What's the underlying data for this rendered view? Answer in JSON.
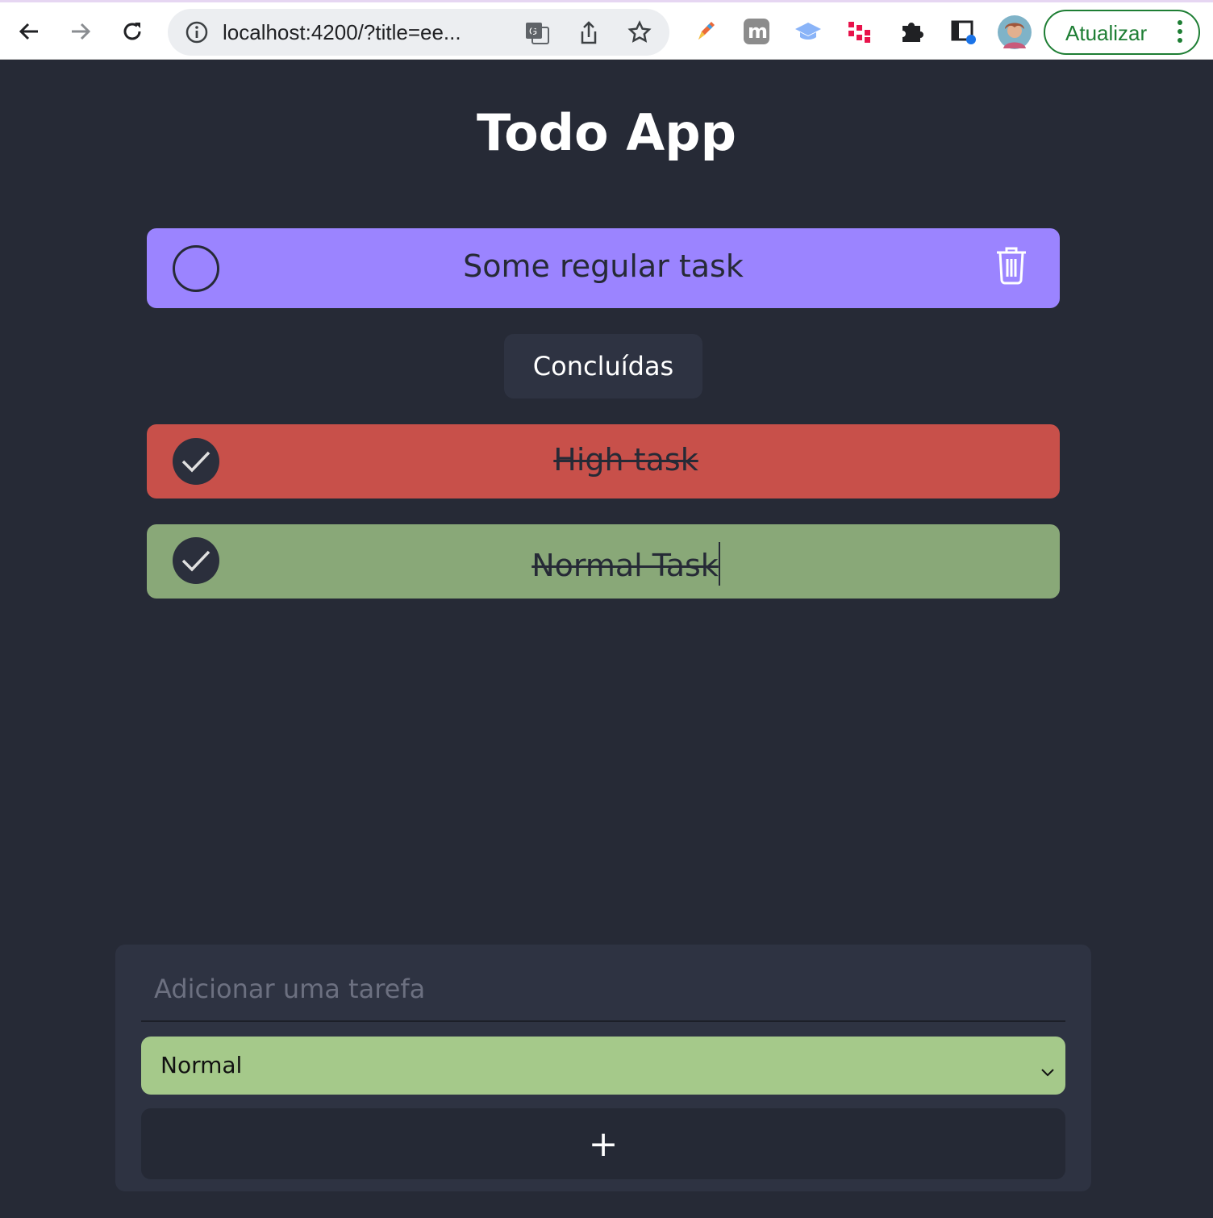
{
  "browser": {
    "url": "localhost:4200/?title=ee...",
    "update_label": "Atualizar"
  },
  "app": {
    "title": "Todo App",
    "tasks": [
      {
        "label": "Some regular task",
        "completed": false,
        "priority_color": "#9b84ff"
      }
    ],
    "completed_section_label": "Concluídas",
    "completed_tasks": [
      {
        "label": "High task",
        "completed": true,
        "priority_color": "#c8504a"
      },
      {
        "label": "Normal Task",
        "completed": true,
        "priority_color": "#89a878"
      }
    ],
    "add_form": {
      "input_placeholder": "Adicionar uma tarefa",
      "priority_selected": "Normal",
      "priority_color": "#a5c98a",
      "add_button_label": "+"
    }
  },
  "colors": {
    "background": "#262a36",
    "panel": "#2e3342"
  }
}
